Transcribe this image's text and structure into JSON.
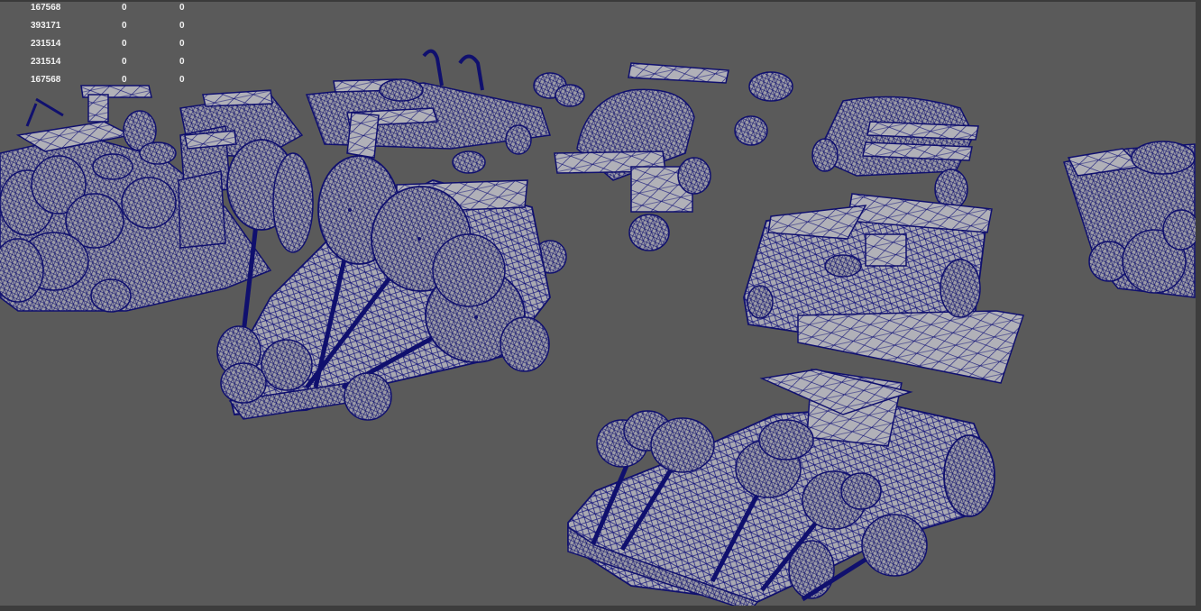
{
  "hud": {
    "rows": [
      {
        "a": "167568",
        "b": "0",
        "c": "0"
      },
      {
        "a": "393171",
        "b": "0",
        "c": "0"
      },
      {
        "a": "231514",
        "b": "0",
        "c": "0"
      },
      {
        "a": "231514",
        "b": "0",
        "c": "0"
      },
      {
        "a": "167568",
        "b": "0",
        "c": "0"
      }
    ]
  },
  "colors": {
    "background": "#5a5a5a",
    "wire": "#10106e",
    "surface": "#a8a8b0",
    "hud_text": "#f2f2f2"
  },
  "scene": {
    "mode": "wireframe-on-shaded",
    "objects": [
      "kart",
      "kart",
      "kart",
      "kart",
      "kart",
      "kart",
      "kart",
      "kart",
      "kart"
    ]
  }
}
